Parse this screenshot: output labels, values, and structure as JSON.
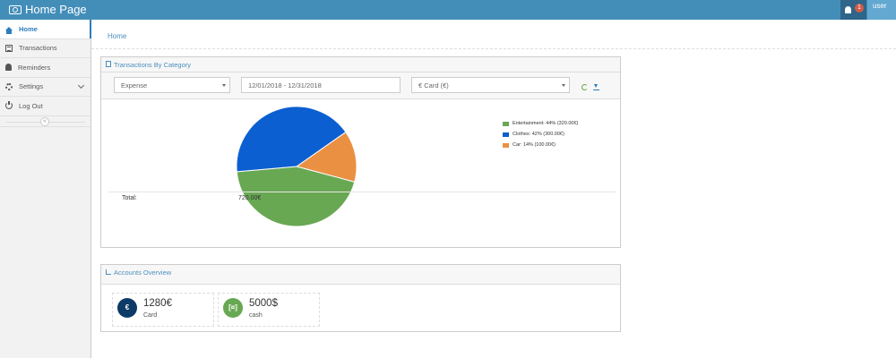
{
  "header": {
    "title": "Home Page",
    "notification_count": "1",
    "user_label": "user"
  },
  "sidebar": {
    "items": [
      {
        "label": "Home",
        "icon": "home-icon"
      },
      {
        "label": "Transactions",
        "icon": "list-icon"
      },
      {
        "label": "Reminders",
        "icon": "bell-icon"
      },
      {
        "label": "Settings",
        "icon": "gear-icon"
      },
      {
        "label": "Log Out",
        "icon": "power-icon"
      }
    ],
    "collapse_glyph": "«"
  },
  "breadcrumb": {
    "current": "Home"
  },
  "transactions_panel": {
    "title": "Transactions By Category",
    "type_select": "Expense",
    "date_range": "12/01/2018 - 12/31/2018",
    "account_select": "€ Card (€)",
    "total_label": "Total:",
    "total_value": "720.00€"
  },
  "chart_data": {
    "type": "pie",
    "categories": [
      "Entertainment",
      "Clothes",
      "Car"
    ],
    "values": [
      320,
      300,
      100
    ],
    "percent": [
      44,
      42,
      14
    ],
    "colors": [
      "#68a853",
      "#0b5fd0",
      "#ea9043"
    ],
    "legend": [
      "Entertainment: 44% (320.00€)",
      "Clothes: 42% (300.00€)",
      "Car: 14% (100.00€)"
    ],
    "legend_placement": "top-right"
  },
  "accounts_panel": {
    "title": "Accounts Overview",
    "accounts": [
      {
        "symbol": "€",
        "amount": "1280€",
        "name": "Card",
        "color": "#0d3a66"
      },
      {
        "symbol": "[¤]",
        "amount": "5000$",
        "name": "cash",
        "color": "#68a853"
      }
    ]
  }
}
